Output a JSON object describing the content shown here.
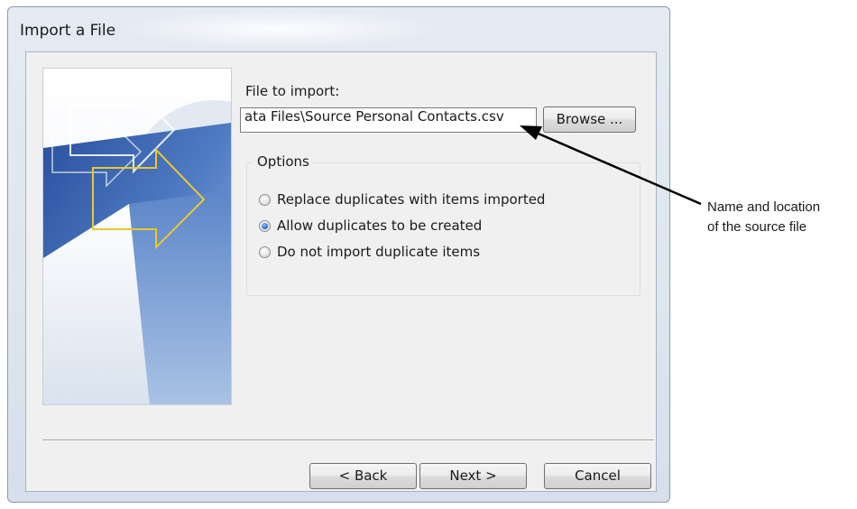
{
  "dialog": {
    "title": "Import a File"
  },
  "file_section": {
    "label": "File to import:",
    "value": "ata Files\\Source Personal Contacts.csv",
    "browse_label": "Browse ..."
  },
  "options": {
    "legend": "Options",
    "items": [
      {
        "label": "Replace duplicates with items imported",
        "checked": false
      },
      {
        "label": "Allow duplicates to be created",
        "checked": true
      },
      {
        "label": "Do not import duplicate items",
        "checked": false
      }
    ]
  },
  "buttons": {
    "back": "< Back",
    "next": "Next >",
    "cancel": "Cancel"
  },
  "callout": {
    "line1": "Name and location",
    "line2": "of the source file"
  },
  "icons": {
    "wizard_image": "import-arrows-graphic",
    "callout_arrow": "callout-arrow-icon"
  }
}
